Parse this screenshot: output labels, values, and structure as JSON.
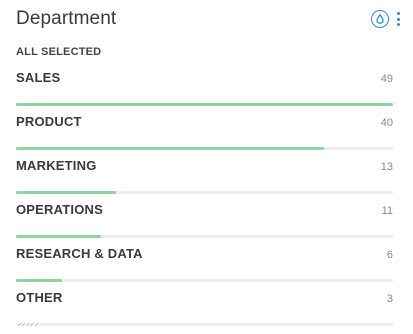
{
  "widget": {
    "title": "Department",
    "subtitle": "ALL SELECTED"
  },
  "icons": {
    "color_by": "droplet-icon",
    "menu": "more-vertical-icon"
  },
  "colors": {
    "accent": "#2e86de",
    "bar_fill": "#8fd4a3",
    "bar_track": "#eeeeee"
  },
  "categories": [
    {
      "label": "SALES",
      "count": "49",
      "fraction": 1.0
    },
    {
      "label": "PRODUCT",
      "count": "40",
      "fraction": 0.8163
    },
    {
      "label": "MARKETING",
      "count": "13",
      "fraction": 0.2653
    },
    {
      "label": "OPERATIONS",
      "count": "11",
      "fraction": 0.2245
    },
    {
      "label": "RESEARCH & DATA",
      "count": "6",
      "fraction": 0.1224
    },
    {
      "label": "OTHER",
      "count": "3",
      "fraction": 0.0612,
      "pattern": "hatched"
    }
  ]
}
